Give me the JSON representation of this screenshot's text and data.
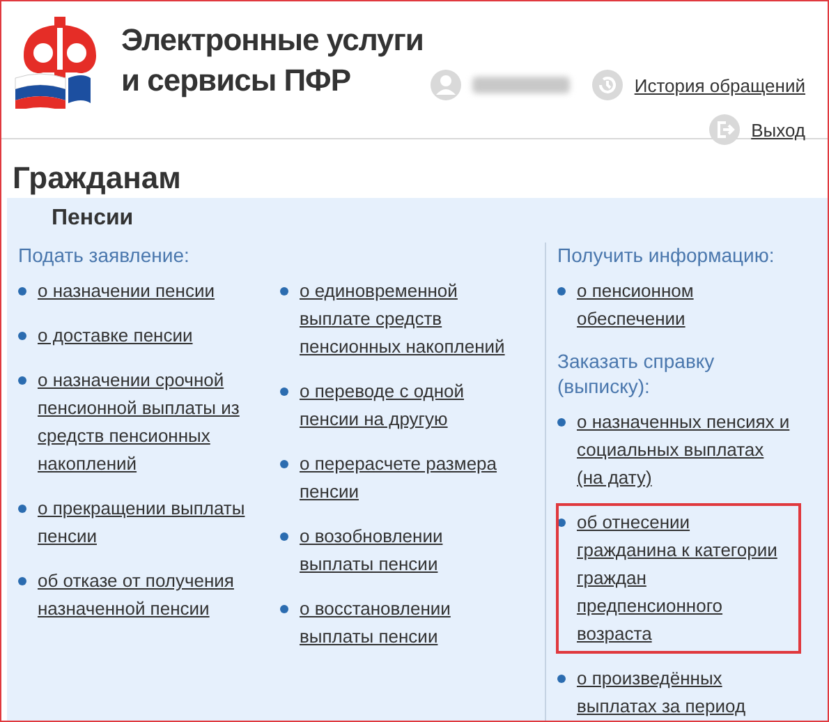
{
  "header": {
    "title_lines": [
      "Электронные услуги",
      "и сервисы ПФР"
    ],
    "links": [
      {
        "kind": "history",
        "label": "История обращений"
      },
      {
        "kind": "logout",
        "label": "Выход"
      }
    ]
  },
  "page_title": "Гражданам",
  "section": {
    "title": "Пенсии",
    "apply": {
      "heading": "Подать заявление:",
      "columns": [
        [
          {
            "label": "о назначении пенсии",
            "highlighted": false
          },
          {
            "label": "о доставке пенсии",
            "highlighted": false
          },
          {
            "label": "о назначении срочной пенсионной выплаты из средств пенсионных накоплений",
            "highlighted": false
          },
          {
            "label": "о прекращении выплаты пенсии",
            "highlighted": false
          },
          {
            "label": "об отказе от получения назначенной пенсии",
            "highlighted": false
          }
        ],
        [
          {
            "label": "о единовременной выплате средств пенсионных накоплений",
            "highlighted": false
          },
          {
            "label": "о переводе с одной пенсии на другую",
            "highlighted": false
          },
          {
            "label": "о перерасчете размера пенсии",
            "highlighted": false
          },
          {
            "label": "о возобновлении выплаты пенсии",
            "highlighted": false
          },
          {
            "label": "о восстановлении выплаты пенсии",
            "highlighted": false
          }
        ]
      ]
    },
    "side": [
      {
        "heading": "Получить информацию:",
        "items": [
          {
            "label": "о пенсионном обеспечении",
            "highlighted": false
          }
        ]
      },
      {
        "heading": "Заказать справку (выписку):",
        "items": [
          {
            "label": "о назначенных пенсиях и социальных выплатах (на дату)",
            "highlighted": false
          },
          {
            "label": "об отнесении гражданина к категории граждан предпенсионного возраста",
            "highlighted": true
          },
          {
            "label": "о произведённых выплатах за период",
            "highlighted": false
          }
        ]
      }
    ]
  }
}
